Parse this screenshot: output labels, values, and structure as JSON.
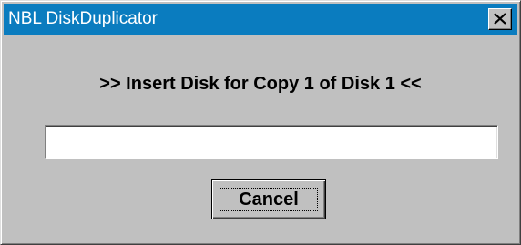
{
  "window": {
    "title": "NBL DiskDuplicator",
    "title_bar_color": "#0a7cbf",
    "face_color": "#c0c0c0",
    "close_icon": "close-icon"
  },
  "dialog": {
    "prompt": ">> Insert Disk for Copy 1 of Disk 1 <<",
    "progress_fraction": 0,
    "cancel_label": "Cancel"
  }
}
